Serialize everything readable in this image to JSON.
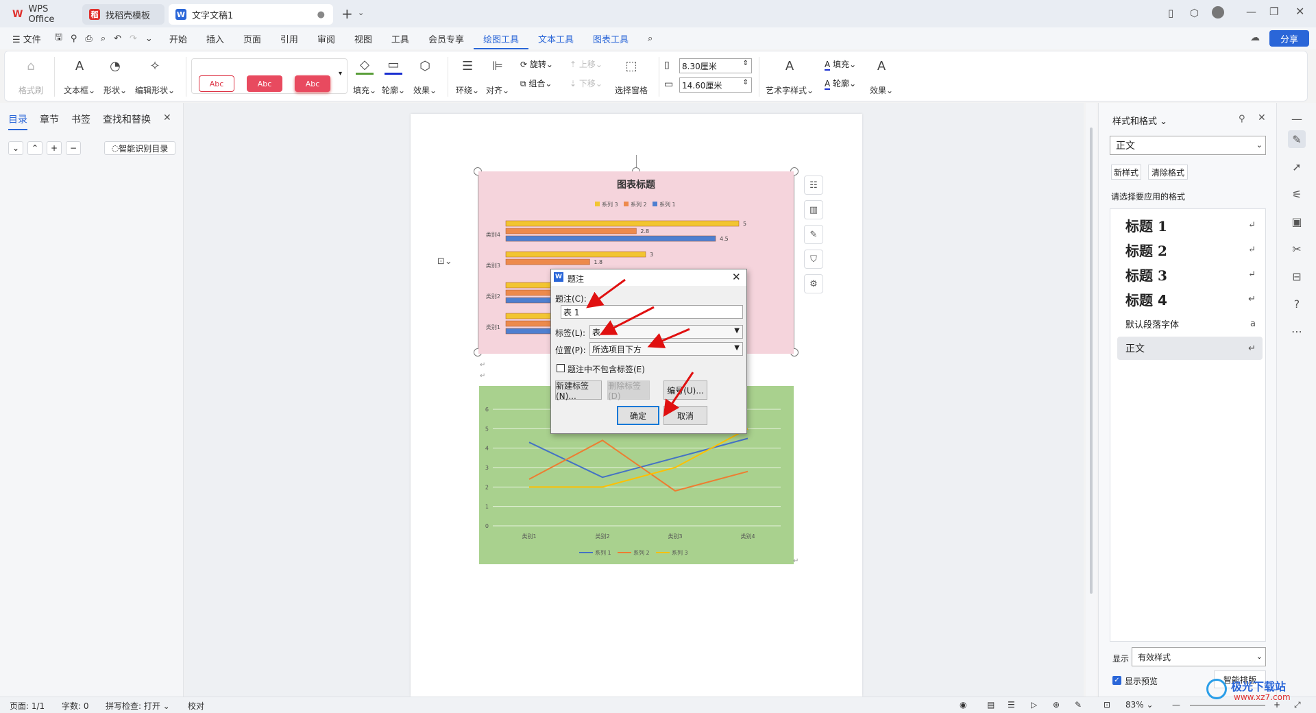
{
  "titlebar": {
    "tabs": [
      "WPS Office",
      "找稻壳模板",
      "文字文稿1"
    ],
    "new_tab": "+",
    "share": "分享"
  },
  "menu": {
    "file": "文件",
    "items": [
      "开始",
      "插入",
      "页面",
      "引用",
      "审阅",
      "视图",
      "工具",
      "会员专享",
      "绘图工具",
      "文本工具",
      "图表工具"
    ],
    "active": "绘图工具"
  },
  "ribbon": {
    "format_brush": "格式刷",
    "textbox": "文本框",
    "shape": "形状",
    "edit_shape": "编辑形状",
    "style_samples": [
      "Abc",
      "Abc",
      "Abc"
    ],
    "fill": "填充",
    "outline": "轮廓",
    "effect": "效果",
    "wrap": "环绕",
    "align": "对齐",
    "rotate": "旋转",
    "group": "组合",
    "move_up": "上移",
    "move_down": "下移",
    "select_pane": "选择窗格",
    "width": "8.30厘米",
    "height": "14.60厘米",
    "art_style": "艺术字样式",
    "fill2": "填充",
    "outline2": "轮廓",
    "effect2": "效果"
  },
  "leftpanel": {
    "tabs": [
      "目录",
      "章节",
      "书签",
      "查找和替换"
    ],
    "smart_toc": "智能识别目录"
  },
  "rightpanel": {
    "title": "样式和格式",
    "current_style": "正文",
    "new_style": "新样式",
    "clear_format": "清除格式",
    "hint": "请选择要应用的格式",
    "styles": [
      "标题 1",
      "标题 2",
      "标题 3",
      "标题 4",
      "默认段落字体",
      "正文"
    ],
    "show_label": "显示",
    "show_value": "有效样式",
    "preview": "显示预览",
    "smart_layout": "智能排版"
  },
  "status": {
    "page": "页面: 1/1",
    "words": "字数: 0",
    "spell": "拼写检查: 打开",
    "proof": "校对",
    "zoom": "83%"
  },
  "chart1": {
    "title": "图表标题",
    "legend": [
      "系列 3",
      "系列 2",
      "系列 1"
    ],
    "categories": [
      "类别4",
      "类别3",
      "类别2",
      "类别1"
    ]
  },
  "chart2": {
    "legend": [
      "系列 1",
      "系列 2",
      "系列 3"
    ],
    "categories": [
      "类别1",
      "类别2",
      "类别3",
      "类别4"
    ],
    "yticks": [
      "6",
      "5",
      "4",
      "3",
      "2",
      "1",
      "0"
    ]
  },
  "chart_data": [
    {
      "type": "bar",
      "title": "图表标题",
      "categories": [
        "类别1",
        "类别2",
        "类别3",
        "类别4"
      ],
      "series": [
        {
          "name": "系列 1",
          "values": [
            null,
            null,
            null,
            4.5
          ]
        },
        {
          "name": "系列 2",
          "values": [
            null,
            null,
            1.8,
            2.8
          ]
        },
        {
          "name": "系列 3",
          "values": [
            null,
            null,
            3,
            5
          ]
        }
      ],
      "labels": [
        "5",
        "2.8",
        "4.5",
        "3",
        "1.8"
      ],
      "xlim": [
        0,
        5
      ],
      "legend": "top",
      "colors": [
        "#f2c531",
        "#ed8a4c",
        "#4e7fd0"
      ]
    },
    {
      "type": "line",
      "categories": [
        "类别1",
        "类别2",
        "类别3",
        "类别4"
      ],
      "series": [
        {
          "name": "系列 1",
          "values": [
            4.3,
            2.5,
            3.5,
            4.5
          ]
        },
        {
          "name": "系列 2",
          "values": [
            2.4,
            4.4,
            1.8,
            2.8
          ]
        },
        {
          "name": "系列 3",
          "values": [
            2,
            2,
            3,
            5
          ]
        }
      ],
      "ylim": [
        0,
        6
      ],
      "legend": "bottom",
      "grid": true,
      "colors": [
        "#4472c4",
        "#ed7d31",
        "#ffc000"
      ]
    }
  ],
  "dialog": {
    "title": "题注",
    "caption_label": "题注(C):",
    "caption_value": "表 1",
    "tag_label": "标签(L):",
    "tag_value": "表",
    "pos_label": "位置(P):",
    "pos_value": "所选项目下方",
    "exclude": "题注中不包含标签(E)",
    "new_tag": "新建标签(N)...",
    "del_tag": "删除标签(D)",
    "numbering": "编号(U)...",
    "ok": "确定",
    "cancel": "取消"
  },
  "watermark": "极光下载站",
  "watermark_url": "www.xz7.com"
}
